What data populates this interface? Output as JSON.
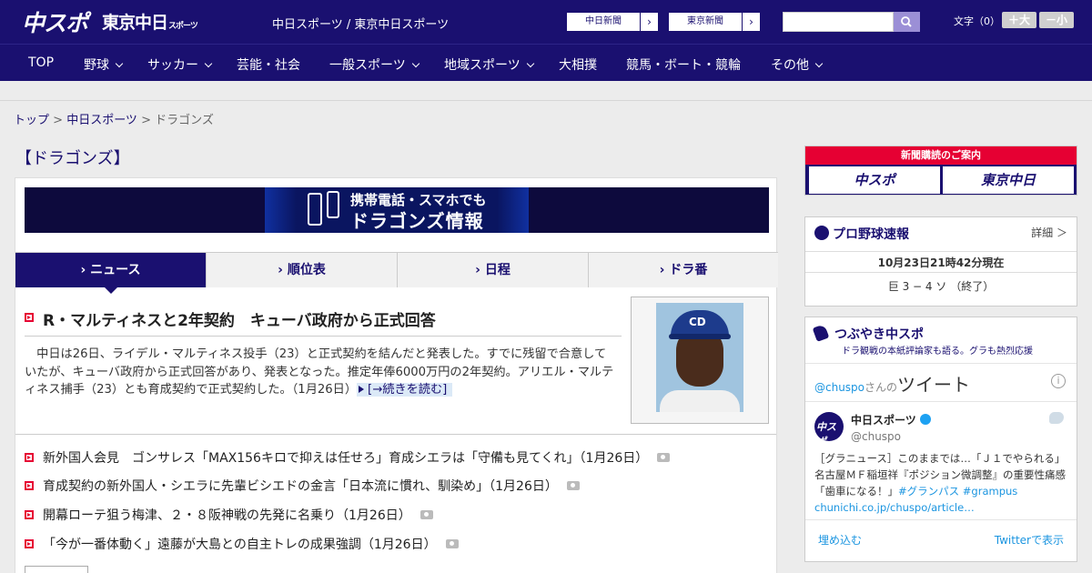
{
  "header": {
    "logo_chuspo": "中スポ",
    "logo_tokyo": "東京中日",
    "logo_tokyo_small": "スポーツ",
    "site_name": "中日スポーツ / 東京中日スポーツ",
    "ext_links": [
      "中日新聞",
      "東京新聞"
    ],
    "font_size_label": "文字（0）",
    "font_plus": "＋大",
    "font_minus": "－小",
    "search_placeholder": ""
  },
  "nav": {
    "items": [
      {
        "label": "TOP"
      },
      {
        "label": "野球"
      },
      {
        "label": "サッカー"
      },
      {
        "label": "芸能・社会"
      },
      {
        "label": "一般スポーツ"
      },
      {
        "label": "地域スポーツ"
      },
      {
        "label": "大相撲"
      },
      {
        "label": "競馬・ボート・競輪"
      },
      {
        "label": "その他"
      }
    ]
  },
  "breadcrumb": {
    "top": "トップ",
    "sep1": " > ",
    "chunichi": "中日スポーツ",
    "sep2": " > ",
    "current": "ドラゴンズ"
  },
  "page_title": "【ドラゴンズ】",
  "banner": {
    "line1": "携帯電話・スマホでも",
    "line2": "ドラゴンズ情報"
  },
  "tabs": [
    "ニュース",
    "順位表",
    "日程",
    "ドラ番"
  ],
  "lead": {
    "title": "R・マルティネスと2年契約　キューバ政府から正式回答",
    "body": "　中日は26日、ライデル・マルティネス投手（23）と正式契約を結んだと発表した。すでに残留で合意していたが、キューバ政府から正式回答があり、発表となった。推定年俸6000万円の2年契約。アリエル・マルティネス捕手（23）とも育成契約で正式契約した。（1月26日）",
    "read_more": "[→続きを読む]"
  },
  "news": [
    "新外国人会見　ゴンサレス「MAX156キロで抑えは任せろ」育成シエラは「守備も見てくれ」（1月26日）",
    "育成契約の新外国人・シエラに先輩ビシエドの金言「日本流に慣れ、馴染め」（1月26日）",
    "開幕ローテ狙う梅津、２・８阪神戦の先発に名乗り（1月26日）",
    "「今が一番体動く」遠藤が大島との自主トレの成果強調（1月26日）"
  ],
  "sidebar": {
    "subscribe_title": "新聞購読のご案内",
    "subscribe_left": "中スポ",
    "subscribe_right": "東京中日",
    "baseball_title": "プロ野球速報",
    "baseball_detail": "詳細 ＞",
    "baseball_time": "10月23日21時42分現在",
    "baseball_score": "巨 3 − 4 ソ （終了）",
    "tweet_title": "つぶやき中スポ",
    "tweet_sub": "ドラ観戦の本紙評論家も語る。グラも熱烈応援",
    "tweet_handle_link": "@chuspo",
    "tweet_suffix": "さんの",
    "tweet_big": "ツイート",
    "tweet_name": "中日スポーツ",
    "tweet_handle": "@chuspo",
    "tweet_text": "［グラニュース］このままでは…「Ｊ１でやられる」名古屋ＭＦ稲垣祥『ポジション微調整』の重要性痛感「歯車になる！」",
    "tweet_tags": "#グランパス #grampus",
    "tweet_link": "chunichi.co.jp/chuspo/article…",
    "tweet_embed": "埋め込む",
    "tweet_view": "Twitterで表示"
  }
}
